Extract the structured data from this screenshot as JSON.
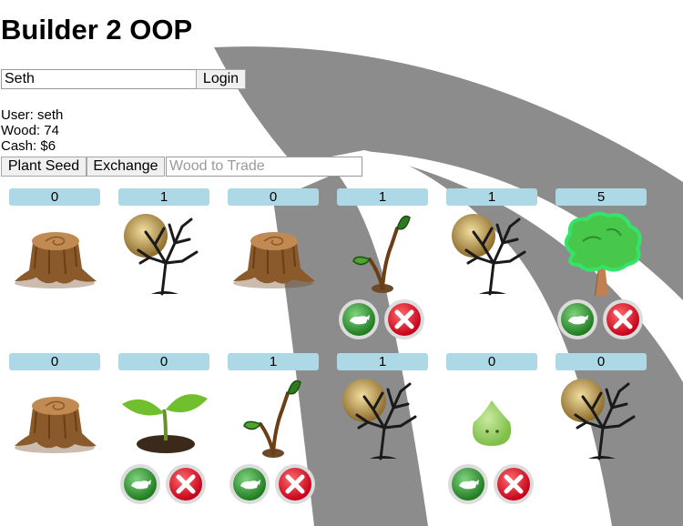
{
  "app": {
    "title": "Builder 2 OOP"
  },
  "login": {
    "name_value": "Seth",
    "login_label": "Login"
  },
  "stats": {
    "user": "User: seth",
    "wood": "Wood: 74",
    "cash": "Cash: $6"
  },
  "toolbar": {
    "plant_seed_label": "Plant Seed",
    "exchange_label": "Exchange",
    "wood_placeholder": "Wood to Trade"
  },
  "grid": {
    "row1": [
      {
        "count": "0",
        "plant": "stump-icon",
        "actions": false
      },
      {
        "count": "1",
        "plant": "dead-tree-icon",
        "actions": false
      },
      {
        "count": "0",
        "plant": "stump-icon",
        "actions": false
      },
      {
        "count": "1",
        "plant": "sapling-icon",
        "actions": true
      },
      {
        "count": "1",
        "plant": "dead-tree-icon",
        "actions": false
      },
      {
        "count": "5",
        "plant": "green-tree-icon",
        "actions": true
      }
    ],
    "row2": [
      {
        "count": "0",
        "plant": "stump-icon",
        "actions": false
      },
      {
        "count": "0",
        "plant": "sprout-icon",
        "actions": true
      },
      {
        "count": "1",
        "plant": "sapling-icon",
        "actions": true
      },
      {
        "count": "1",
        "plant": "dead-tree-icon",
        "actions": false
      },
      {
        "count": "0",
        "plant": "seed-icon",
        "actions": true
      },
      {
        "count": "0",
        "plant": "dead-tree-icon",
        "actions": false
      }
    ]
  },
  "colors": {
    "count_badge": "#add8e6",
    "road": "#8c8c8c",
    "water_button": "#3a9a3a",
    "remove_button": "#e0202a"
  }
}
